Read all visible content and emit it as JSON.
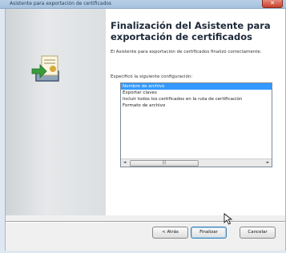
{
  "window": {
    "title": "Asistente para exportación de certificados",
    "close_label": "✕"
  },
  "main": {
    "heading": "Finalización del Asistente para exportación de certificados",
    "description": "El Asistente para exportación de certificados finalizó correctamente.",
    "spec_label": "Especificó la siguiente configuración:",
    "settings_list": [
      "Nombre de archivo",
      "Exportar claves",
      "Incluir todos los certificados en la ruta de certificación",
      "Formato de archivo"
    ],
    "selected_index": 0
  },
  "scrollbar": {
    "left_arrow": "◄",
    "right_arrow": "►",
    "thumb_grip": "|||"
  },
  "buttons": {
    "back": "< Atrás",
    "finish": "Finalizar",
    "cancel": "Cancelar"
  },
  "icons": {
    "wizard": "certificate-export-icon",
    "cursor": "mouse-pointer-icon"
  }
}
